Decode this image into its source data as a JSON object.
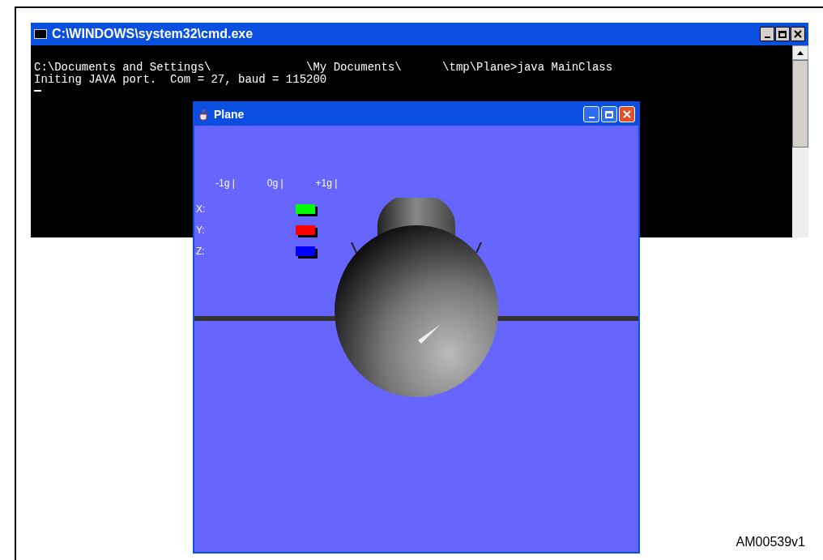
{
  "console_window": {
    "title": "C:\\WINDOWS\\system32\\cmd.exe",
    "lines": [
      "C:\\Documents and Settings\\              \\My Documents\\      \\tmp\\Plane>java MainClass",
      "Initing JAVA port.  Com = 27, baud = 115200"
    ]
  },
  "plane_window": {
    "title": "Plane",
    "scale": [
      "-1g |",
      "0g |",
      "+1g |"
    ],
    "axes": [
      {
        "label": "X:",
        "color": "#00ff00"
      },
      {
        "label": "Y:",
        "color": "#ff0000"
      },
      {
        "label": "Z:",
        "color": "#0000ff"
      }
    ]
  },
  "figure_id": "AM00539v1"
}
